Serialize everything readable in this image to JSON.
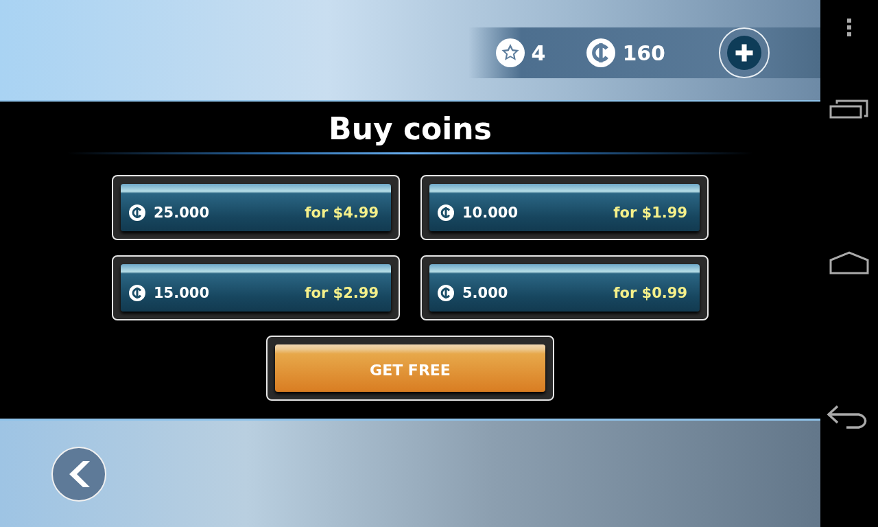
{
  "header": {
    "stars": "4",
    "coins": "160"
  },
  "title": "Buy coins",
  "packs": [
    {
      "amount": "25.000",
      "price": "for $4.99"
    },
    {
      "amount": "10.000",
      "price": "for $1.99"
    },
    {
      "amount": "15.000",
      "price": "for $2.99"
    },
    {
      "amount": "5.000",
      "price": "for $0.99"
    }
  ],
  "free_button": "GET FREE"
}
